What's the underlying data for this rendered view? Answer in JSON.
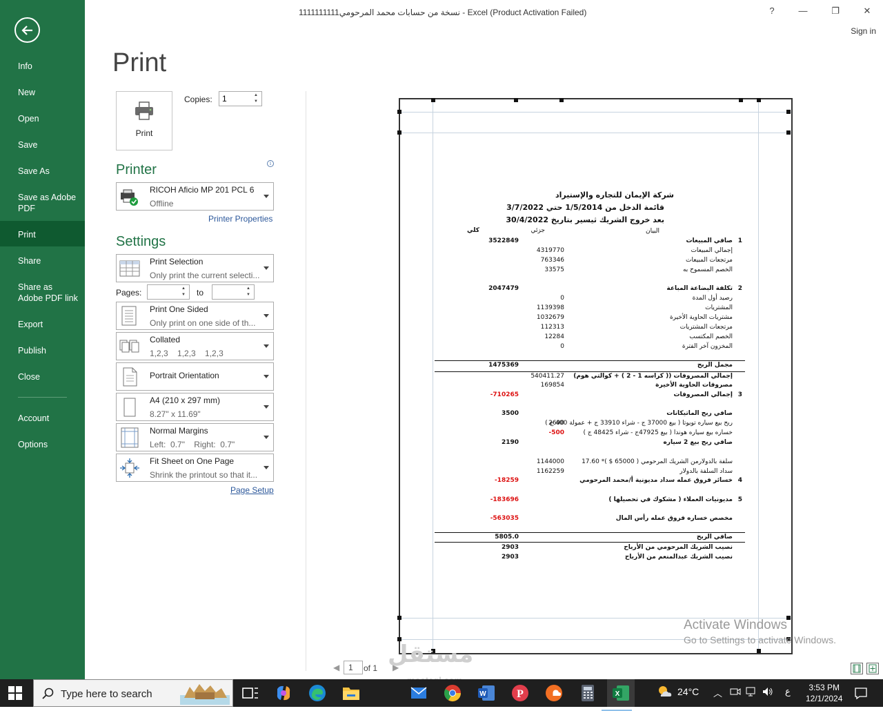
{
  "window": {
    "title": "1111111111نسخة من حسابات محمد المرحومي - Excel (Product Activation Failed)",
    "help": "?",
    "minimize": "—",
    "restore": "❐",
    "close": "✕",
    "sign_in": "Sign in"
  },
  "sidebar": {
    "items": [
      "Info",
      "New",
      "Open",
      "Save",
      "Save As",
      "Save as Adobe PDF",
      "Print",
      "Share",
      "Share as Adobe PDF link",
      "Export",
      "Publish",
      "Close",
      "Account",
      "Options"
    ],
    "active": "Print"
  },
  "print_panel": {
    "title": "Print",
    "print_button": "Print",
    "copies_label": "Copies:",
    "copies_value": "1",
    "printer_heading": "Printer",
    "printer_name": "RICOH Aficio MP 201 PCL 6",
    "printer_status": "Offline",
    "printer_properties": "Printer Properties",
    "settings_heading": "Settings",
    "what": {
      "title": "Print Selection",
      "desc": "Only print the current selecti..."
    },
    "pages_label": "Pages:",
    "to_label": "to",
    "sides": {
      "title": "Print One Sided",
      "desc": "Only print on one side of th..."
    },
    "collation": {
      "title": "Collated",
      "desc": "1,2,3    1,2,3    1,2,3"
    },
    "orientation": {
      "title": "Portrait Orientation"
    },
    "paper": {
      "title": "A4 (210 x 297 mm)",
      "desc": "8.27\" x 11.69\""
    },
    "margins": {
      "title": "Normal Margins",
      "desc": "Left:  0.7\"    Right:  0.7\""
    },
    "scaling": {
      "title": "Fit Sheet on One Page",
      "desc": "Shrink the printout so that it..."
    },
    "page_setup": "Page Setup"
  },
  "preview": {
    "company": "شركة الإيمان للتجاره والإستيراد",
    "statement": "قائمة الدخل من 1/5/2014 حتي 3/7/2022",
    "subtitle": "بعد خروج الشريك ثيسير بتاريخ 30/4/2022",
    "col_desc": "البيان",
    "col_partial": "جزئي",
    "col_total": "كلي",
    "rows": [
      {
        "no": "1",
        "label": "صافي المبيعات",
        "partial": "",
        "total": "3522849",
        "bold": true
      },
      {
        "no": "",
        "label": "إجمالي المبيعات",
        "partial": "4319770",
        "total": ""
      },
      {
        "no": "",
        "label": "مرتجعات المبيعات",
        "partial": "763346",
        "total": ""
      },
      {
        "no": "",
        "label": "الخصم المسموح به",
        "partial": "33575",
        "total": ""
      },
      {
        "no": "2",
        "label": "تكلفة البضاعة المباعة",
        "partial": "",
        "total": "2047479",
        "bold": true
      },
      {
        "no": "",
        "label": "رصيد أول المدة",
        "partial": "0",
        "total": ""
      },
      {
        "no": "",
        "label": "المشتريات",
        "partial": "1139398",
        "total": ""
      },
      {
        "no": "",
        "label": "مشتريات الحاوية الأخيرة",
        "partial": "1032679",
        "total": ""
      },
      {
        "no": "",
        "label": "مرتجعات المشتريات",
        "partial": "112313",
        "total": ""
      },
      {
        "no": "",
        "label": "الخصم المكتسب",
        "partial": "12284",
        "total": ""
      },
      {
        "no": "",
        "label": "المخزون آخر الفترة",
        "partial": "0",
        "total": ""
      },
      {
        "no": "",
        "label": "مجمل الربح",
        "partial": "",
        "total": "1475369",
        "bold": true
      },
      {
        "no": "",
        "label": "إجمالي المصروفات (( كراسه 1 - 2 ) + كوالتي هوم)",
        "partial": "540411.27",
        "total": "",
        "bold": true
      },
      {
        "no": "",
        "label": "مصروفات الحاوية الأخيرة",
        "partial": "169854",
        "total": "",
        "bold": true
      },
      {
        "no": "3",
        "label": "إجمالي المصروفات",
        "partial": "",
        "total": "-710265",
        "bold": true,
        "red": true
      },
      {
        "no": "",
        "label": "صافي ربح الماتيكانات",
        "partial": "",
        "total": "3500",
        "bold": true
      },
      {
        "no": "",
        "label": "ربح بيع سياره تويوتا ( بيع 37000 ج - شراء 33910 ج + عمولة 400 ج )",
        "partial": "2690",
        "total": ""
      },
      {
        "no": "",
        "label": "خساره بيع سياره هوندا  ( بيع  47925ج - شراء 48425 ج )",
        "partial": "-500",
        "total": "",
        "red_partial": true
      },
      {
        "no": "",
        "label": "صافي ربح بيع  2 سياره",
        "partial": "",
        "total": "2190",
        "bold": true
      },
      {
        "no": "",
        "label": "سلفة  بالدولارمن الشريك المرحومي ( 65000 $ )* 17.60",
        "partial": "1144000",
        "total": ""
      },
      {
        "no": "",
        "label": "سداد السلفة بالدولار",
        "partial": "1162259",
        "total": ""
      },
      {
        "no": "4",
        "label": "خسائر فروق عمله سداد مديونية أ/محمد المرحومي",
        "partial": "",
        "total": "-18259",
        "bold": true,
        "red": true
      },
      {
        "no": "5",
        "label": "مديونيات العملاء ( مشكوك في تحصيلها )",
        "partial": "",
        "total": "-183696",
        "bold": true,
        "red": true
      },
      {
        "no": "",
        "label": "مخصص خساره فروق عمله رأس المال",
        "partial": "",
        "total": "-563035",
        "bold": true,
        "red": true
      },
      {
        "no": "",
        "label": "صافي الربح",
        "partial": "",
        "total": "5805.0",
        "bold": true
      },
      {
        "no": "",
        "label": "نصيب الشريك المرحومي من الأرباح",
        "partial": "",
        "total": "2903",
        "bold": true
      },
      {
        "no": "",
        "label": "نصيب الشريك عبدالمنعم من الأرباح",
        "partial": "",
        "total": "2903",
        "bold": true
      }
    ]
  },
  "page_nav": {
    "current": "1",
    "of": "of 1"
  },
  "activation": {
    "line1": "Activate Windows",
    "line2": "Go to Settings to activate Windows."
  },
  "watermark": {
    "text": "مستقل",
    "sub": "mostaql.com"
  },
  "taskbar": {
    "search_placeholder": "Type here to search",
    "weather": "24°C",
    "time": "3:53 PM",
    "date": "12/1/2024",
    "lang": "ع",
    "apps": [
      "task-view",
      "copilot",
      "edge",
      "file-explorer",
      "mail",
      "chrome",
      "word",
      "pinterest",
      "soundcloud",
      "calculator",
      "excel"
    ]
  },
  "colors": {
    "accent": "#217346",
    "active_nav": "#0f5a30",
    "negative": "#dd1111"
  }
}
